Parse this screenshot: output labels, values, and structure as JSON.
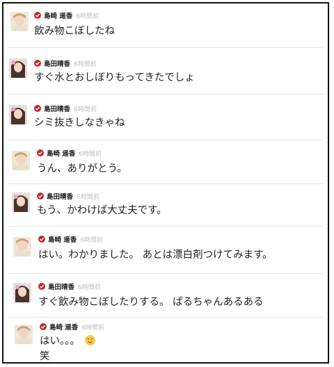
{
  "messages": [
    {
      "user": "島崎 遥香",
      "time": "6時間前",
      "text": "飲み物こぼしたね",
      "avatar": "paru"
    },
    {
      "user": "島田晴香",
      "time": "6時間前",
      "text": "すぐ水とおしぼりもってきたでしょ",
      "avatar": "haruka"
    },
    {
      "user": "島田晴香",
      "time": "6時間前",
      "text": "シミ抜きしなきゃね",
      "avatar": "haruka"
    },
    {
      "user": "島崎 遥香",
      "time": "6時間前",
      "text": "うん、ありがとう。",
      "avatar": "paru"
    },
    {
      "user": "島田晴香",
      "time": "6時間前",
      "text": "もう、かわけば大丈夫です。",
      "avatar": "haruka"
    },
    {
      "user": "島崎 遥香",
      "time": "6時間前",
      "text": "はい。わかりました。 あとは漂白剤つけてみます。",
      "avatar": "paru"
    },
    {
      "user": "島田晴香",
      "time": "6時間前",
      "text": "すぐ飲み物こぼしたりする。 ぱるちゃんあるある",
      "avatar": "haruka"
    },
    {
      "user": "島崎 遥香",
      "time": "6時間前",
      "text": "はい。。。",
      "text2": "笑",
      "avatar": "paru",
      "emoji": "sweat-smile-emoji"
    }
  ],
  "colors": {
    "badge": "#c62828",
    "time": "#bdbdbd",
    "divider": "#e6e6e6"
  }
}
